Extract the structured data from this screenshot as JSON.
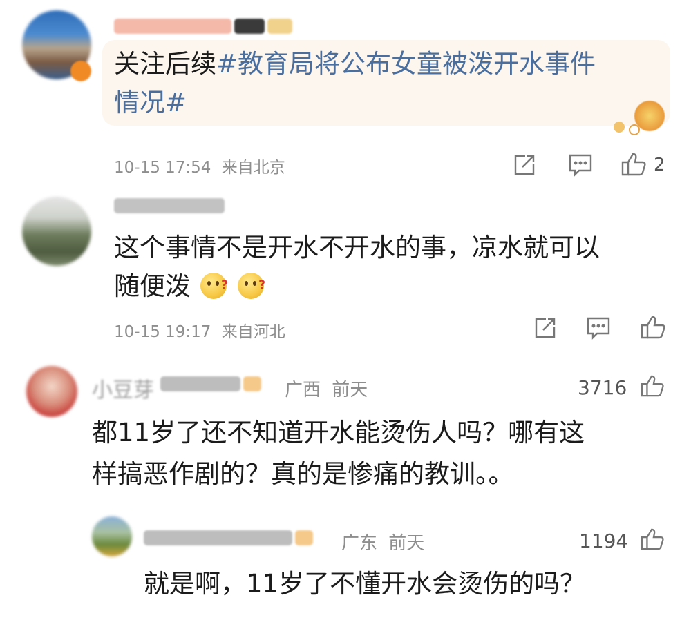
{
  "comments": [
    {
      "body_prefix": "关注后续",
      "hashtag_line1": "#教育局将公布女童被泼开水事件",
      "hashtag_line2": "情况#",
      "time": "10-15 17:54",
      "source": "来自北京",
      "like_count": "2"
    },
    {
      "line1": "这个事情不是开水不开水的事，凉水就可以",
      "line2": "随便泼",
      "emojis": [
        "thinking-emoji",
        "thinking-emoji"
      ],
      "time": "10-15 19:17",
      "source": "来自河北"
    },
    {
      "username": "小豆芽",
      "region": "广西",
      "when": "前天",
      "like_count": "3716",
      "line1": "都11岁了还不知道开水能烫伤人吗？哪有这",
      "line2": "样搞恶作剧的？真的是惨痛的教训。。"
    },
    {
      "region": "广东",
      "when": "前天",
      "like_count": "1194",
      "line1": "就是啊，11岁了不懂开水会烫伤的吗？"
    }
  ],
  "icons": {
    "share": "share-icon",
    "comment": "comment-icon",
    "like": "thumbs-up-icon",
    "badge": "vip-badge-icon"
  },
  "colors": {
    "hashtag": "#4a6f9e",
    "meta": "#8e8e8e",
    "bubble": "#fdf6ee",
    "badge": "#f5c98a"
  }
}
